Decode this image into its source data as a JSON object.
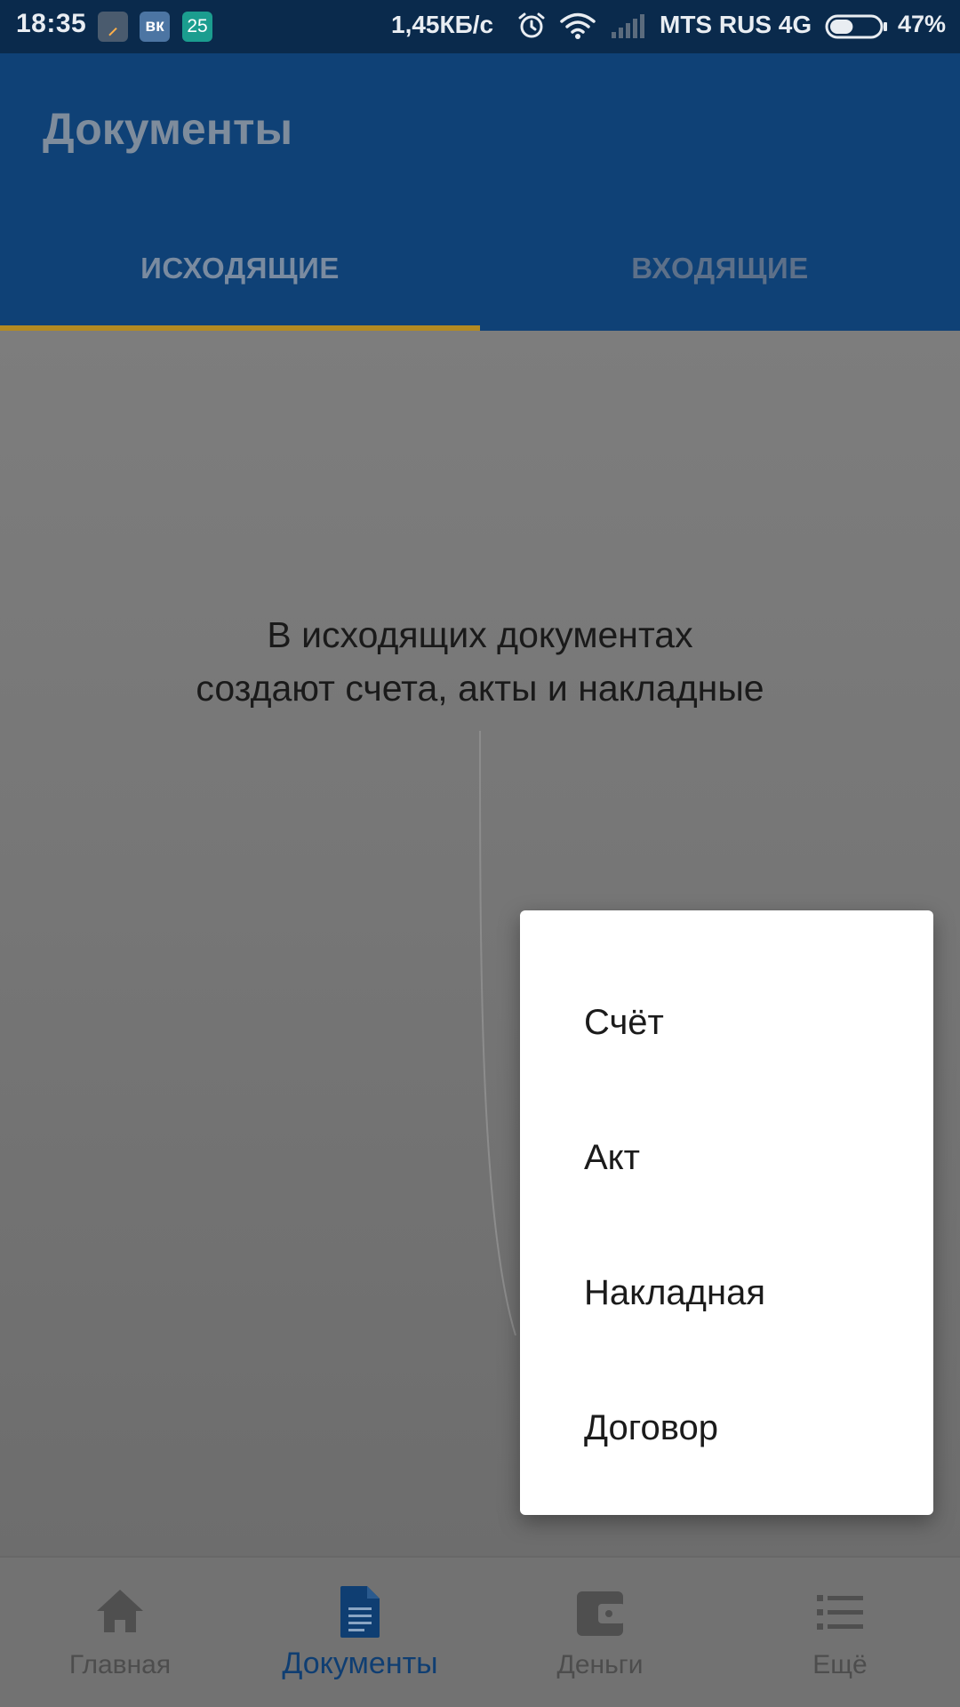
{
  "status_bar": {
    "time": "18:35",
    "notification_vk": "вк",
    "notification_count": "25",
    "network_speed": "1,45КБ/с",
    "carrier": "MTS RUS 4G",
    "battery_percent": "47%",
    "battery_level": 0.47,
    "icons": [
      "app-notification-icon",
      "vk-icon",
      "calendar-badge-icon",
      "alarm-icon",
      "wifi-icon",
      "signal-icon",
      "battery-icon"
    ]
  },
  "app_bar": {
    "title": "Документы",
    "tabs": [
      {
        "label": "ИСХОДЯЩИЕ",
        "selected": true
      },
      {
        "label": "ВХОДЯЩИЕ",
        "selected": false
      }
    ],
    "accent_color": "#0f4176",
    "indicator_color": "#b38a22"
  },
  "main": {
    "empty_line_1": "В исходящих документах",
    "empty_line_2": "создают счета, акты и накладные"
  },
  "popup_menu": {
    "items": [
      {
        "label": "Счёт"
      },
      {
        "label": "Акт"
      },
      {
        "label": "Накладная"
      },
      {
        "label": "Договор"
      }
    ]
  },
  "bottom_nav": {
    "items": [
      {
        "label": "Главная",
        "icon": "home-icon",
        "active": false
      },
      {
        "label": "Документы",
        "icon": "document-icon",
        "active": true
      },
      {
        "label": "Деньги",
        "icon": "wallet-icon",
        "active": false
      },
      {
        "label": "Ещё",
        "icon": "list-icon",
        "active": false
      }
    ],
    "active_color": "#0f3e72"
  }
}
